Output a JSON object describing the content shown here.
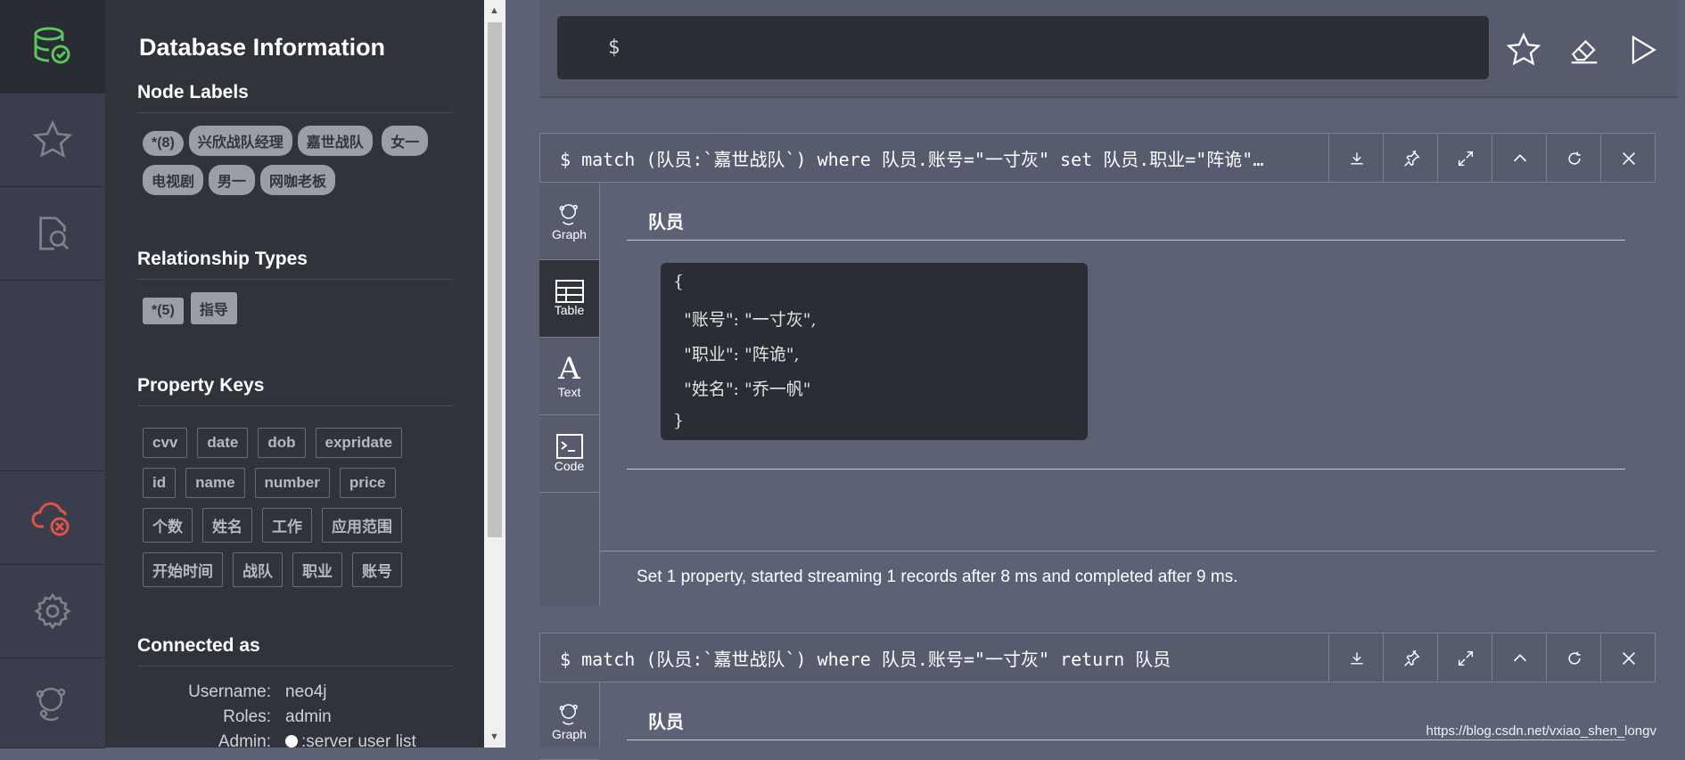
{
  "sidebar": {
    "title": "Database Information",
    "node_labels_heading": "Node Labels",
    "node_labels": [
      "*(8)",
      "兴欣战队经理",
      "嘉世战队",
      "女一",
      "电视剧",
      "男一",
      "网咖老板"
    ],
    "relationship_heading": "Relationship Types",
    "relationship_types": [
      "*(5)",
      "指导"
    ],
    "property_heading": "Property Keys",
    "property_keys": [
      "cvv",
      "date",
      "dob",
      "expridate",
      "id",
      "name",
      "number",
      "price",
      "个数",
      "姓名",
      "工作",
      "应用范围",
      "开始时间",
      "战队",
      "职业",
      "账号"
    ],
    "connected_heading": "Connected as",
    "username_label": "Username:",
    "username": "neo4j",
    "roles_label": "Roles:",
    "roles": "admin",
    "admin_label": "Admin:",
    "admin_value": ":server user list"
  },
  "editor": {
    "prompt": "$"
  },
  "frame1": {
    "query": "$ match (队员:`嘉世战队`) where 队员.账号=\"一寸灰\" set 队员.职业=\"阵诡\"…",
    "tabs": [
      "Graph",
      "Table",
      "Text",
      "Code"
    ],
    "active_tab": "Table",
    "column": "队员",
    "json_lines": [
      "{",
      "  \"账号\": \"一寸灰\",",
      "  \"职业\": \"阵诡\",",
      "  \"姓名\": \"乔一帆\"",
      "}"
    ],
    "status": "Set 1 property, started streaming 1 records after 8 ms and completed after 9 ms."
  },
  "frame2": {
    "query": "$ match (队员:`嘉世战队`) where 队员.账号=\"一寸灰\" return 队员",
    "first_tab": "Graph",
    "column": "队员"
  },
  "watermark": "https://blog.csdn.net/vxiao_shen_longv",
  "colors": {
    "accent_green": "#5cc65c",
    "alert_red": "#e0524a"
  }
}
